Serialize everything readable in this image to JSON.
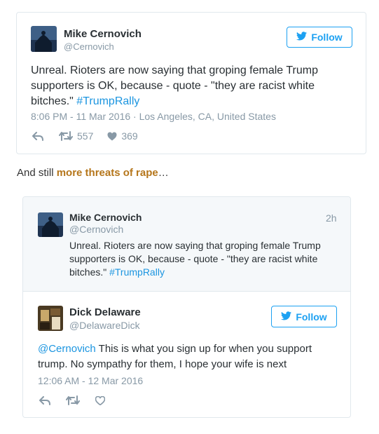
{
  "tweet1": {
    "author_name": "Mike Cernovich",
    "author_handle": "@Cernovich",
    "follow_label": "Follow",
    "text_main": "Unreal. Rioters are now saying that groping female Trump supporters is OK, because - quote - \"they are racist white bitches.\"",
    "hashtag": "#TrumpRally",
    "time": "8:06 PM - 11 Mar 2016",
    "separator": "·",
    "location": "Los Angeles, CA, United States",
    "retweets": "557",
    "likes": "369"
  },
  "prose": {
    "prefix": "And still ",
    "link": "more threats of rape",
    "suffix": "…"
  },
  "reply_card": {
    "quoted": {
      "author_name": "Mike Cernovich",
      "author_handle": "@Cernovich",
      "age": "2h",
      "text_main": "Unreal. Rioters are now saying that groping female Trump supporters is OK, because - quote - \"they are racist white bitches.\"",
      "hashtag": "#TrumpRally"
    },
    "reply": {
      "author_name": "Dick Delaware",
      "author_handle": "@DelawareDick",
      "follow_label": "Follow",
      "mention": "@Cernovich",
      "text_main": " This is what you sign up for when you support trump. No sympathy for them, I hope your wife is next",
      "time": "12:06 AM - 12 Mar 2016"
    }
  },
  "icons": {
    "follow": "twitter-bird-icon",
    "reply": "reply-arrow-icon",
    "retweet": "retweet-icon",
    "like": "heart-icon"
  },
  "colors": {
    "twitter_blue": "#1da1f2",
    "link_blue": "#1b95e0",
    "muted": "#8899a6",
    "text": "#292f33",
    "border": "#e1e8ed",
    "quoted_bg": "#f5f8fa",
    "prose_link": "#b5761b"
  }
}
